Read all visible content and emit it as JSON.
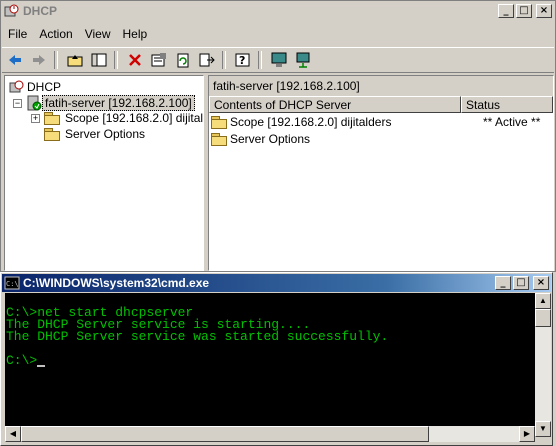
{
  "dhcp_window": {
    "title": "DHCP",
    "menu": [
      "File",
      "Action",
      "View",
      "Help"
    ],
    "toolbar_icons": [
      "back-icon",
      "forward-icon",
      "up-folder-icon",
      "show-hide-tree-icon",
      "delete-icon",
      "properties-icon",
      "refresh-icon",
      "export-icon",
      "help-icon",
      "computer-icon",
      "connect-icon"
    ],
    "tree": {
      "root": "DHCP",
      "server": "fatih-server [192.168.2.100]",
      "scope": "Scope [192.168.2.0] dijitald",
      "server_options": "Server Options"
    },
    "list_pane": {
      "header": "fatih-server [192.168.2.100]",
      "columns": [
        "Contents of DHCP Server",
        "Status"
      ],
      "rows": [
        {
          "name": "Scope [192.168.2.0] dijitalders",
          "status": "** Active **"
        },
        {
          "name": "Server Options",
          "status": ""
        }
      ]
    }
  },
  "cmd_window": {
    "title": "C:\\WINDOWS\\system32\\cmd.exe",
    "lines": [
      "C:\\>net start dhcpserver",
      "The DHCP Server service is starting....",
      "The DHCP Server service was started successfully.",
      "",
      "C:\\>"
    ]
  },
  "colors": {
    "title_active": "#0a246a",
    "console_bg": "#000000",
    "console_text": "#00c000"
  }
}
